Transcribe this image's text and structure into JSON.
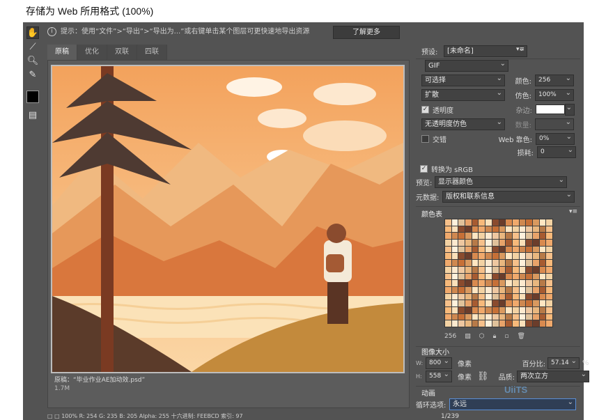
{
  "window": {
    "title": "存储为 Web 所用格式 (100%)"
  },
  "toolbar": {
    "tools": [
      "hand-icon",
      "slice-select-icon",
      "zoom-icon",
      "eyedropper-icon",
      "eyedropper-color",
      "preview-browser-icon"
    ],
    "eyedropper_color": "#000000"
  },
  "hint": {
    "text": "提示：使用“文件”>“导出”>“导出为...”或右键单击某个图层可更快速地导出资源",
    "learn_more": "了解更多"
  },
  "tabs": [
    "原稿",
    "优化",
    "双联",
    "四联"
  ],
  "canvas": {
    "info_line1": "原稿：“毕业作业AE加动效.psd”",
    "info_line2": "1.7M"
  },
  "status": {
    "text": "□ □ 100%  R: 254  G: 235  B: 205  Alpha: 255  十六进制: FEEBCD  索引: 97"
  },
  "settings": {
    "preset_label": "预设:",
    "preset_value": "[未命名]",
    "format": "GIF",
    "reduction": "可选择",
    "colors_label": "颜色:",
    "colors_value": "256",
    "dither_algo": "扩散",
    "dither_label": "仿色:",
    "dither_value": "100%",
    "transparency_label": "透明度",
    "matte_label": "杂边:",
    "trans_dither": "无透明度仿色",
    "amount_label": "数量:",
    "interlaced_label": "交错",
    "websnap_label": "Web 靠色:",
    "websnap_value": "0%",
    "lossy_label": "损耗:",
    "lossy_value": "0",
    "convert_srgb": "转换为 sRGB",
    "preview_label": "预览:",
    "preview_value": "显示器颜色",
    "metadata_label": "元数据:",
    "metadata_value": "版权和联系信息"
  },
  "color_table": {
    "title": "颜色表",
    "count": "256"
  },
  "image_size": {
    "title": "图像大小",
    "w_label": "W:",
    "w_value": "800",
    "h_label": "H:",
    "h_value": "558",
    "unit": "像素",
    "percent_label": "百分比:",
    "percent_value": "57.14",
    "percent_unit": "%",
    "quality_label": "品质:",
    "quality_value": "两次立方"
  },
  "animation": {
    "title": "动画",
    "loop_label": "循环选项:",
    "loop_value": "永远",
    "frame": "1/239"
  },
  "watermark": "UiiTS"
}
